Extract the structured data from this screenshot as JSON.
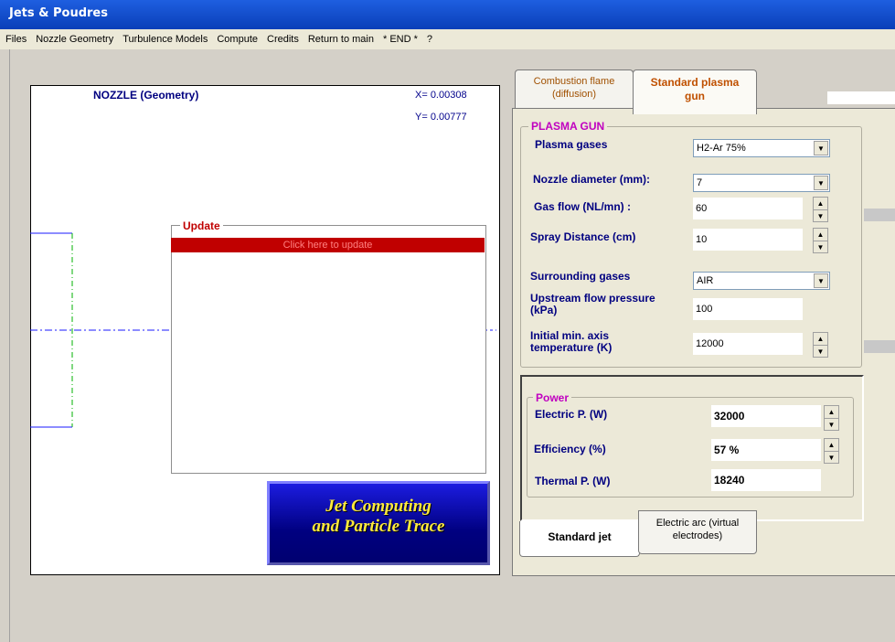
{
  "app": {
    "title": "Jets & Poudres"
  },
  "menu": [
    "Files",
    "Nozzle Geometry",
    "Turbulence Models",
    "Compute",
    "Credits",
    "Return to main",
    "* END *",
    "?"
  ],
  "canvas": {
    "title": "NOZZLE (Geometry)",
    "x_readout": "X= 0.00308",
    "y_readout": "Y= 0.00777"
  },
  "update": {
    "title": "Update",
    "button": "Click here to update"
  },
  "jet_button": {
    "line1": "Jet Computing",
    "line2": "and Particle  Trace"
  },
  "tabs": {
    "combustion_l1": "Combustion flame",
    "combustion_l2": "(diffusion)",
    "plasma_l1": "Standard plasma",
    "plasma_l2": "gun"
  },
  "plasma": {
    "group": "PLASMA GUN",
    "gases_label": "Plasma  gases",
    "gases_value": "H2-Ar 75%",
    "nozzle_label": "Nozzle diameter (mm):",
    "nozzle_value": "7",
    "gasflow_label": "Gas flow (NL/mn) :",
    "gasflow_value": "60",
    "spray_label": "Spray Distance  (cm)",
    "spray_value": "10",
    "surround_label": "Surrounding  gases",
    "surround_value": "AIR",
    "upstream_l1": "Upstream flow pressure",
    "upstream_l2": "(kPa)",
    "upstream_value": "100",
    "initial_l1": "Initial min. axis",
    "initial_l2": "temperature (K)",
    "initial_value": "12000"
  },
  "power": {
    "group": "Power",
    "electric_label": "Electric P. (W)",
    "electric_value": "32000",
    "efficiency_label": "Efficiency (%)",
    "efficiency_value": "57 %",
    "thermal_label": "Thermal P. (W)",
    "thermal_value": "18240"
  },
  "bottom_tabs": {
    "standard": "Standard jet",
    "arc_l1": "Electric arc (virtual",
    "arc_l2": "electrodes)"
  }
}
